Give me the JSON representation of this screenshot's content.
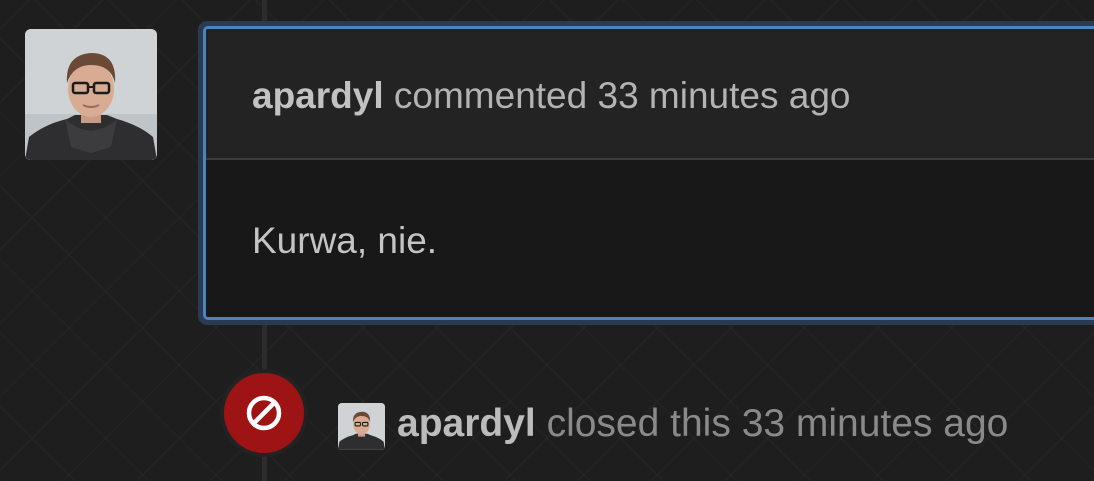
{
  "comment": {
    "avatar_icon": "user-avatar",
    "author": "apardyl",
    "action": "commented",
    "time": "33 minutes ago",
    "body": "Kurwa, nie.",
    "highlight_color": "#4a84c1"
  },
  "event": {
    "icon": "closed-circle-slash-icon",
    "badge_color": "#9e1414",
    "author": "apardyl",
    "action": "closed this",
    "time": "33 minutes ago"
  }
}
